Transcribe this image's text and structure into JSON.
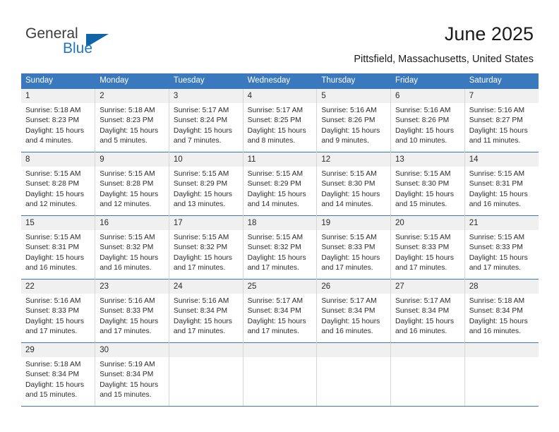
{
  "brand": {
    "name_part1": "General",
    "name_part2": "Blue",
    "logo_icon": "triangle-icon",
    "accent_color": "#1064a8",
    "blue_text_color": "#1d77c4"
  },
  "header": {
    "title": "June 2025",
    "location": "Pittsfield, Massachusetts, United States"
  },
  "calendar": {
    "header_bg_color": "#3b79be",
    "daynum_bg_color": "#f0f0f0",
    "weekday_headers": [
      "Sunday",
      "Monday",
      "Tuesday",
      "Wednesday",
      "Thursday",
      "Friday",
      "Saturday"
    ],
    "labels": {
      "sunrise_prefix": "Sunrise:",
      "sunset_prefix": "Sunset:",
      "daylight_prefix": "Daylight:"
    },
    "weeks": [
      [
        {
          "day": "1",
          "sunrise": "Sunrise: 5:18 AM",
          "sunset": "Sunset: 8:23 PM",
          "daylight_line1": "Daylight: 15 hours",
          "daylight_line2": "and 4 minutes."
        },
        {
          "day": "2",
          "sunrise": "Sunrise: 5:18 AM",
          "sunset": "Sunset: 8:23 PM",
          "daylight_line1": "Daylight: 15 hours",
          "daylight_line2": "and 5 minutes."
        },
        {
          "day": "3",
          "sunrise": "Sunrise: 5:17 AM",
          "sunset": "Sunset: 8:24 PM",
          "daylight_line1": "Daylight: 15 hours",
          "daylight_line2": "and 7 minutes."
        },
        {
          "day": "4",
          "sunrise": "Sunrise: 5:17 AM",
          "sunset": "Sunset: 8:25 PM",
          "daylight_line1": "Daylight: 15 hours",
          "daylight_line2": "and 8 minutes."
        },
        {
          "day": "5",
          "sunrise": "Sunrise: 5:16 AM",
          "sunset": "Sunset: 8:26 PM",
          "daylight_line1": "Daylight: 15 hours",
          "daylight_line2": "and 9 minutes."
        },
        {
          "day": "6",
          "sunrise": "Sunrise: 5:16 AM",
          "sunset": "Sunset: 8:26 PM",
          "daylight_line1": "Daylight: 15 hours",
          "daylight_line2": "and 10 minutes."
        },
        {
          "day": "7",
          "sunrise": "Sunrise: 5:16 AM",
          "sunset": "Sunset: 8:27 PM",
          "daylight_line1": "Daylight: 15 hours",
          "daylight_line2": "and 11 minutes."
        }
      ],
      [
        {
          "day": "8",
          "sunrise": "Sunrise: 5:15 AM",
          "sunset": "Sunset: 8:28 PM",
          "daylight_line1": "Daylight: 15 hours",
          "daylight_line2": "and 12 minutes."
        },
        {
          "day": "9",
          "sunrise": "Sunrise: 5:15 AM",
          "sunset": "Sunset: 8:28 PM",
          "daylight_line1": "Daylight: 15 hours",
          "daylight_line2": "and 12 minutes."
        },
        {
          "day": "10",
          "sunrise": "Sunrise: 5:15 AM",
          "sunset": "Sunset: 8:29 PM",
          "daylight_line1": "Daylight: 15 hours",
          "daylight_line2": "and 13 minutes."
        },
        {
          "day": "11",
          "sunrise": "Sunrise: 5:15 AM",
          "sunset": "Sunset: 8:29 PM",
          "daylight_line1": "Daylight: 15 hours",
          "daylight_line2": "and 14 minutes."
        },
        {
          "day": "12",
          "sunrise": "Sunrise: 5:15 AM",
          "sunset": "Sunset: 8:30 PM",
          "daylight_line1": "Daylight: 15 hours",
          "daylight_line2": "and 14 minutes."
        },
        {
          "day": "13",
          "sunrise": "Sunrise: 5:15 AM",
          "sunset": "Sunset: 8:30 PM",
          "daylight_line1": "Daylight: 15 hours",
          "daylight_line2": "and 15 minutes."
        },
        {
          "day": "14",
          "sunrise": "Sunrise: 5:15 AM",
          "sunset": "Sunset: 8:31 PM",
          "daylight_line1": "Daylight: 15 hours",
          "daylight_line2": "and 16 minutes."
        }
      ],
      [
        {
          "day": "15",
          "sunrise": "Sunrise: 5:15 AM",
          "sunset": "Sunset: 8:31 PM",
          "daylight_line1": "Daylight: 15 hours",
          "daylight_line2": "and 16 minutes."
        },
        {
          "day": "16",
          "sunrise": "Sunrise: 5:15 AM",
          "sunset": "Sunset: 8:32 PM",
          "daylight_line1": "Daylight: 15 hours",
          "daylight_line2": "and 16 minutes."
        },
        {
          "day": "17",
          "sunrise": "Sunrise: 5:15 AM",
          "sunset": "Sunset: 8:32 PM",
          "daylight_line1": "Daylight: 15 hours",
          "daylight_line2": "and 17 minutes."
        },
        {
          "day": "18",
          "sunrise": "Sunrise: 5:15 AM",
          "sunset": "Sunset: 8:32 PM",
          "daylight_line1": "Daylight: 15 hours",
          "daylight_line2": "and 17 minutes."
        },
        {
          "day": "19",
          "sunrise": "Sunrise: 5:15 AM",
          "sunset": "Sunset: 8:33 PM",
          "daylight_line1": "Daylight: 15 hours",
          "daylight_line2": "and 17 minutes."
        },
        {
          "day": "20",
          "sunrise": "Sunrise: 5:15 AM",
          "sunset": "Sunset: 8:33 PM",
          "daylight_line1": "Daylight: 15 hours",
          "daylight_line2": "and 17 minutes."
        },
        {
          "day": "21",
          "sunrise": "Sunrise: 5:15 AM",
          "sunset": "Sunset: 8:33 PM",
          "daylight_line1": "Daylight: 15 hours",
          "daylight_line2": "and 17 minutes."
        }
      ],
      [
        {
          "day": "22",
          "sunrise": "Sunrise: 5:16 AM",
          "sunset": "Sunset: 8:33 PM",
          "daylight_line1": "Daylight: 15 hours",
          "daylight_line2": "and 17 minutes."
        },
        {
          "day": "23",
          "sunrise": "Sunrise: 5:16 AM",
          "sunset": "Sunset: 8:33 PM",
          "daylight_line1": "Daylight: 15 hours",
          "daylight_line2": "and 17 minutes."
        },
        {
          "day": "24",
          "sunrise": "Sunrise: 5:16 AM",
          "sunset": "Sunset: 8:34 PM",
          "daylight_line1": "Daylight: 15 hours",
          "daylight_line2": "and 17 minutes."
        },
        {
          "day": "25",
          "sunrise": "Sunrise: 5:17 AM",
          "sunset": "Sunset: 8:34 PM",
          "daylight_line1": "Daylight: 15 hours",
          "daylight_line2": "and 17 minutes."
        },
        {
          "day": "26",
          "sunrise": "Sunrise: 5:17 AM",
          "sunset": "Sunset: 8:34 PM",
          "daylight_line1": "Daylight: 15 hours",
          "daylight_line2": "and 16 minutes."
        },
        {
          "day": "27",
          "sunrise": "Sunrise: 5:17 AM",
          "sunset": "Sunset: 8:34 PM",
          "daylight_line1": "Daylight: 15 hours",
          "daylight_line2": "and 16 minutes."
        },
        {
          "day": "28",
          "sunrise": "Sunrise: 5:18 AM",
          "sunset": "Sunset: 8:34 PM",
          "daylight_line1": "Daylight: 15 hours",
          "daylight_line2": "and 16 minutes."
        }
      ],
      [
        {
          "day": "29",
          "sunrise": "Sunrise: 5:18 AM",
          "sunset": "Sunset: 8:34 PM",
          "daylight_line1": "Daylight: 15 hours",
          "daylight_line2": "and 15 minutes."
        },
        {
          "day": "30",
          "sunrise": "Sunrise: 5:19 AM",
          "sunset": "Sunset: 8:34 PM",
          "daylight_line1": "Daylight: 15 hours",
          "daylight_line2": "and 15 minutes."
        },
        {
          "day": "",
          "sunrise": "",
          "sunset": "",
          "daylight_line1": "",
          "daylight_line2": ""
        },
        {
          "day": "",
          "sunrise": "",
          "sunset": "",
          "daylight_line1": "",
          "daylight_line2": ""
        },
        {
          "day": "",
          "sunrise": "",
          "sunset": "",
          "daylight_line1": "",
          "daylight_line2": ""
        },
        {
          "day": "",
          "sunrise": "",
          "sunset": "",
          "daylight_line1": "",
          "daylight_line2": ""
        },
        {
          "day": "",
          "sunrise": "",
          "sunset": "",
          "daylight_line1": "",
          "daylight_line2": ""
        }
      ]
    ]
  }
}
